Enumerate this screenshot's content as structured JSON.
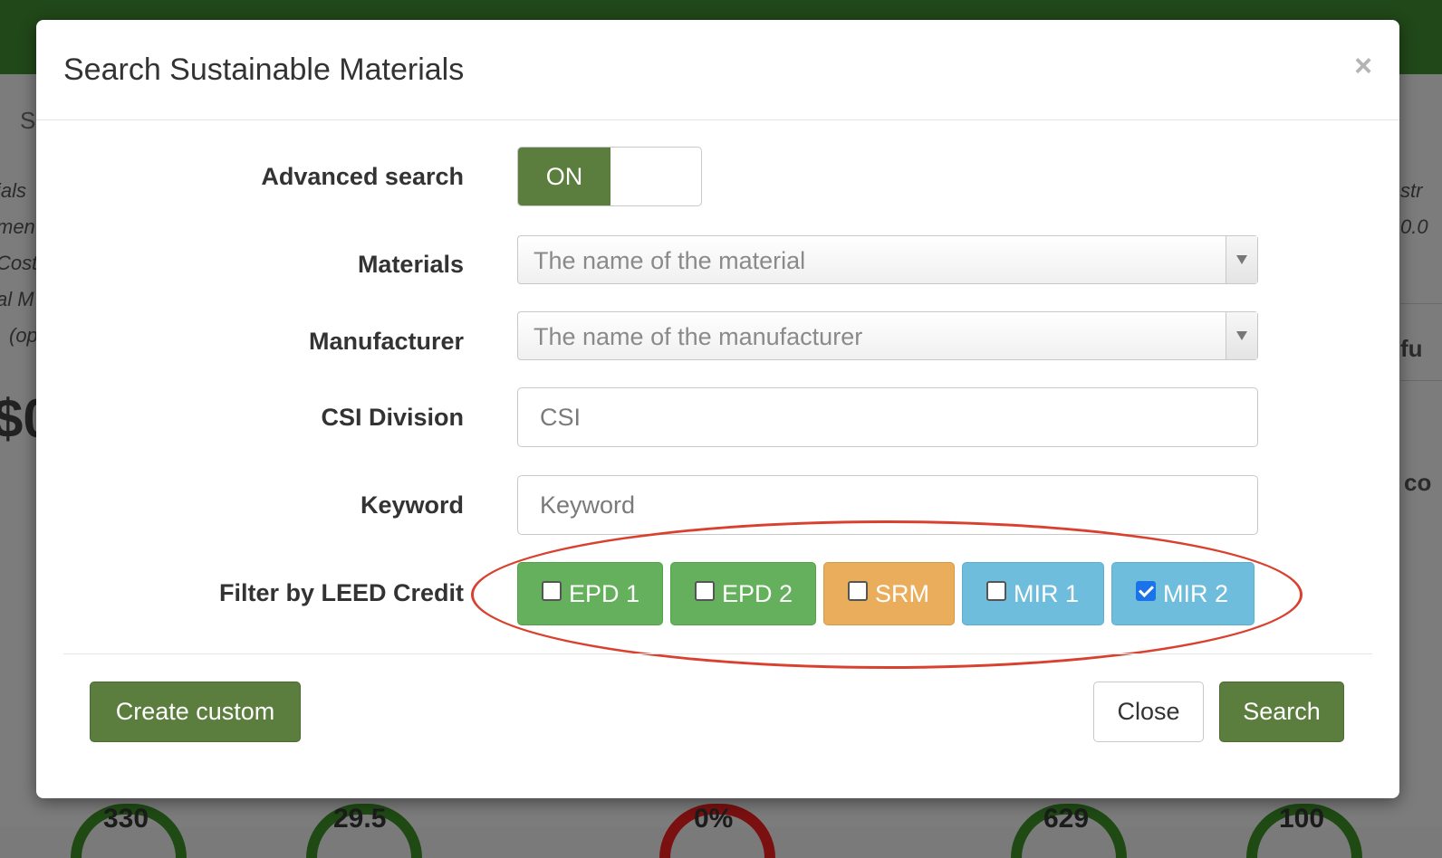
{
  "background": {
    "side_text_left": [
      "ials",
      "men",
      "Cost",
      "al M",
      "(op"
    ],
    "side_text_right": [
      "str",
      "0.0"
    ],
    "bold_right": [
      "fu",
      "co"
    ],
    "big_left": "$0",
    "tab_letter": "S",
    "gauge_values": [
      "330",
      "29.5",
      "0%",
      "629",
      "100"
    ]
  },
  "modal": {
    "title": "Search Sustainable Materials",
    "close_symbol": "×",
    "advanced_search": {
      "label": "Advanced search",
      "state": "ON"
    },
    "materials": {
      "label": "Materials",
      "placeholder": "The name of the material"
    },
    "manufacturer": {
      "label": "Manufacturer",
      "placeholder": "The name of the manufacturer"
    },
    "csi_division": {
      "label": "CSI Division",
      "placeholder": "CSI"
    },
    "keyword": {
      "label": "Keyword",
      "placeholder": "Keyword"
    },
    "leed_filter": {
      "label": "Filter by LEED Credit",
      "credits": [
        {
          "label": "EPD 1",
          "checked": false,
          "color": "#64b05c"
        },
        {
          "label": "EPD 2",
          "checked": false,
          "color": "#64b05c"
        },
        {
          "label": "SRM",
          "checked": false,
          "color": "#e9ad5b"
        },
        {
          "label": "MIR 1",
          "checked": false,
          "color": "#6fbddd"
        },
        {
          "label": "MIR 2",
          "checked": true,
          "color": "#6fbddd"
        }
      ]
    },
    "footer": {
      "create_custom": "Create custom",
      "close": "Close",
      "search": "Search"
    }
  },
  "colors": {
    "primary_green": "#5b7d3d",
    "annotation_red": "#d9402e",
    "topbar": "#214819"
  }
}
